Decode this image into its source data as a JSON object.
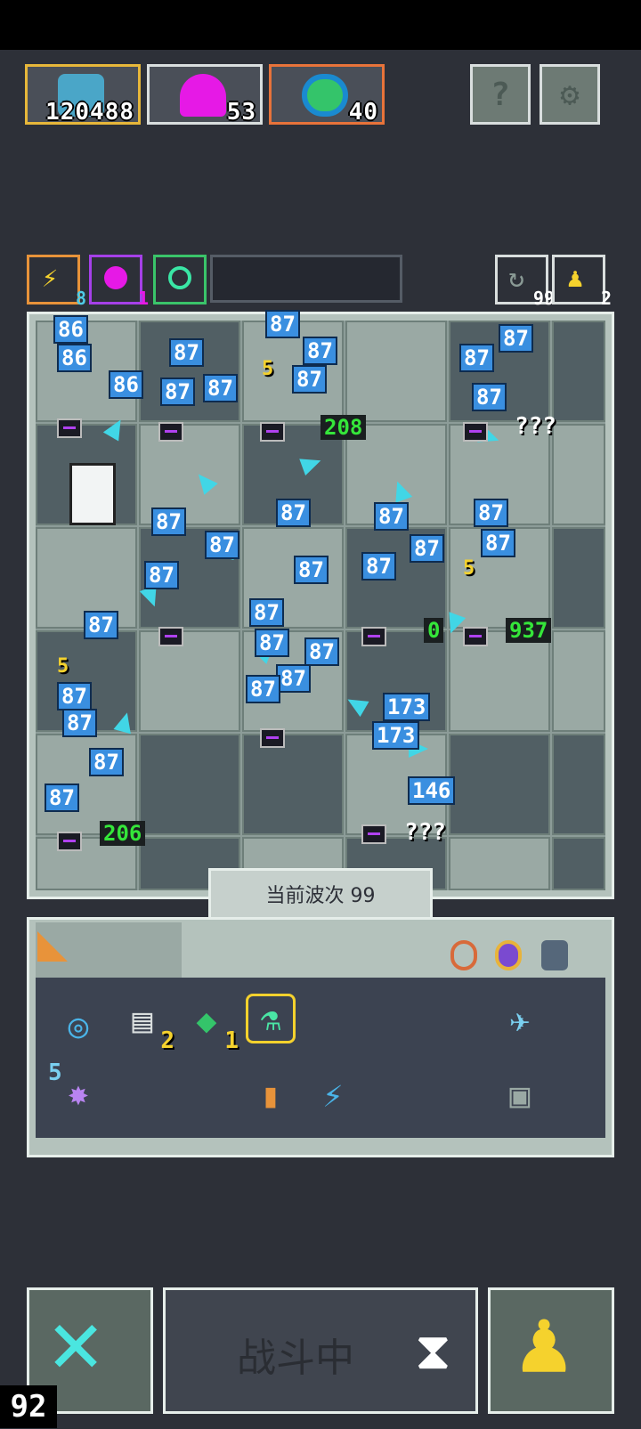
{
  "resources": {
    "coins": "120488",
    "gems": "53",
    "orbs": "40"
  },
  "top_buttons": {
    "help_label": "?",
    "settings_icon": "gear-icon"
  },
  "mini_slots": {
    "energy_count": "8",
    "purple_count": "1",
    "refresh_count": "99",
    "pawn_count": "2"
  },
  "board": {
    "damage_numbers": [
      "86",
      "86",
      "86",
      "87",
      "87",
      "87",
      "87",
      "87",
      "87",
      "87",
      "87",
      "87",
      "87",
      "87",
      "87",
      "87",
      "87",
      "87",
      "87",
      "87",
      "87",
      "87",
      "87",
      "87",
      "87",
      "87",
      "87",
      "87",
      "87",
      "87",
      "87",
      "87",
      "173",
      "173",
      "146"
    ],
    "counts": [
      "208",
      "937",
      "0",
      "206"
    ],
    "unknown": [
      "???",
      "???"
    ],
    "yellow_marks": [
      "5",
      "5",
      "5"
    ]
  },
  "wave_label": "当前波次 99",
  "inventory": {
    "scroll_count": "2",
    "gem_count": "1",
    "star_level": "5"
  },
  "battle_status": "战斗中",
  "fps": "92"
}
